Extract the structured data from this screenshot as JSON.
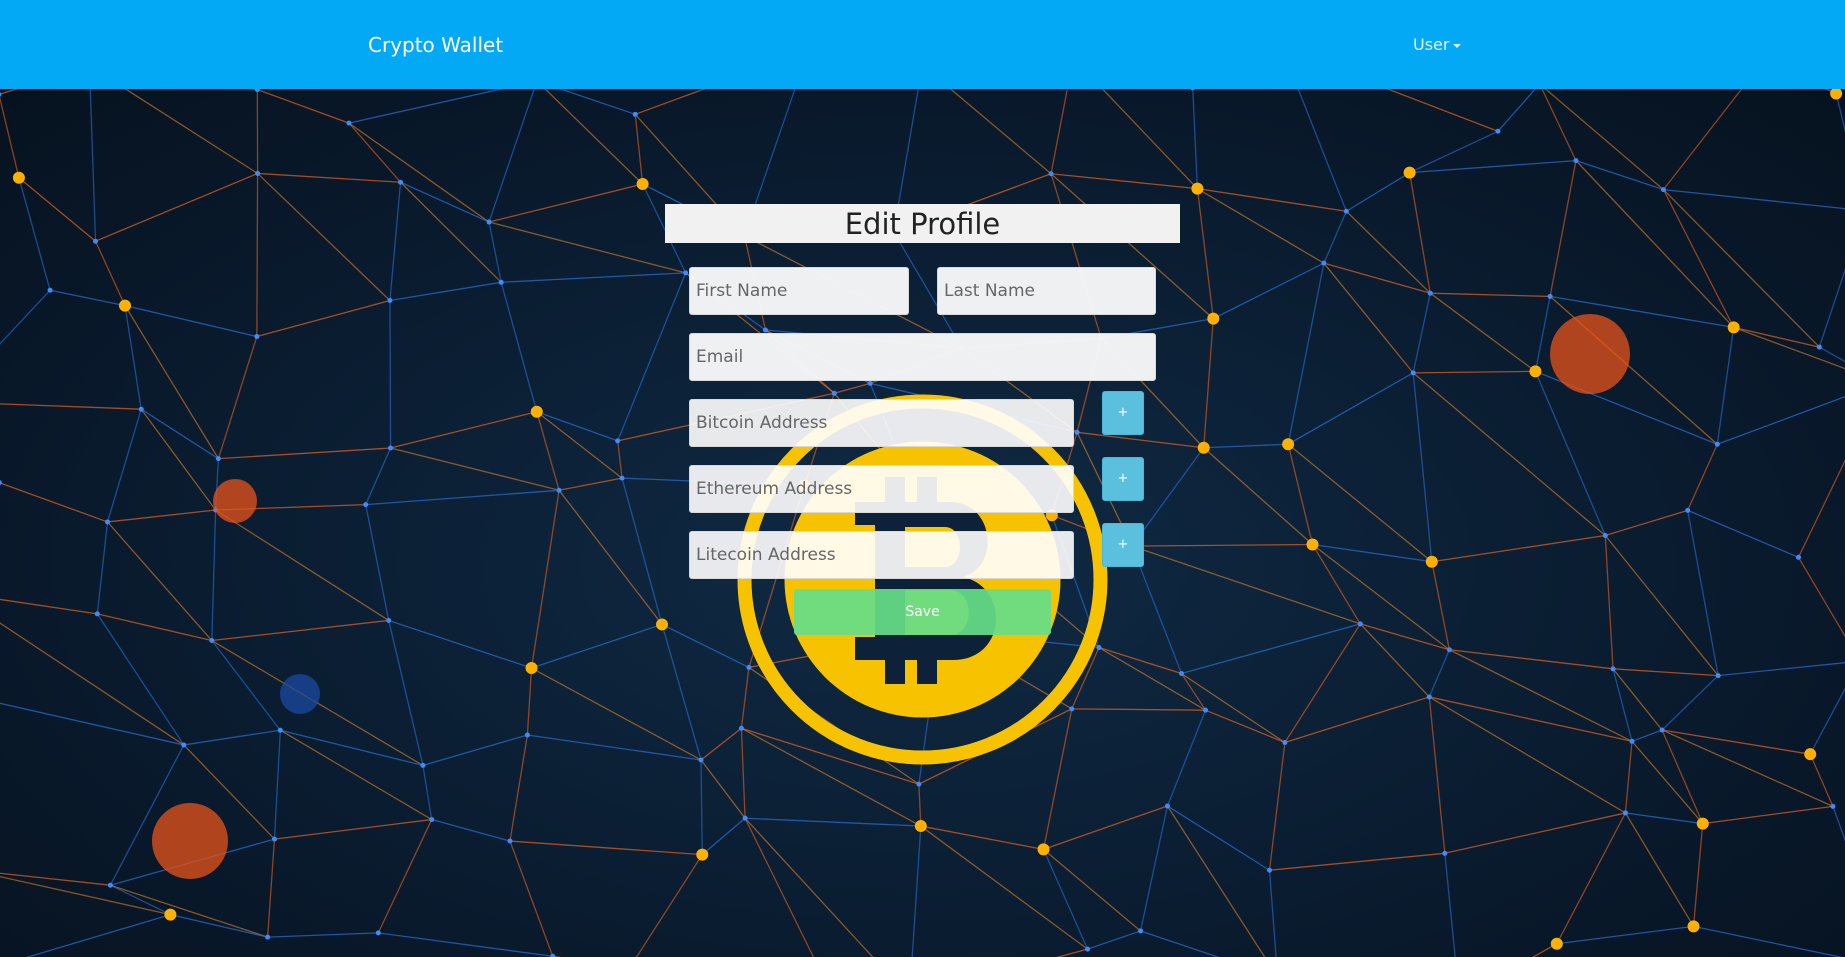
{
  "navbar": {
    "brand": "Crypto Wallet",
    "user_menu": "User"
  },
  "form": {
    "title": "Edit Profile",
    "first_name_placeholder": "First Name",
    "last_name_placeholder": "Last Name",
    "email_placeholder": "Email",
    "bitcoin_placeholder": "Bitcoin Address",
    "ethereum_placeholder": "Ethereum Address",
    "litecoin_placeholder": "Litecoin Address",
    "add_bitcoin_label": "+",
    "add_ethereum_label": "+",
    "add_litecoin_label": "+",
    "save_label": "Save"
  },
  "colors": {
    "navbar": "#03a9f4",
    "add_button": "#5bc0de",
    "save_button": "#66de88",
    "bitcoin_gold": "#f7c300"
  },
  "icons": {
    "background_logo": "bitcoin-logo-icon",
    "caret": "caret-down-icon"
  }
}
